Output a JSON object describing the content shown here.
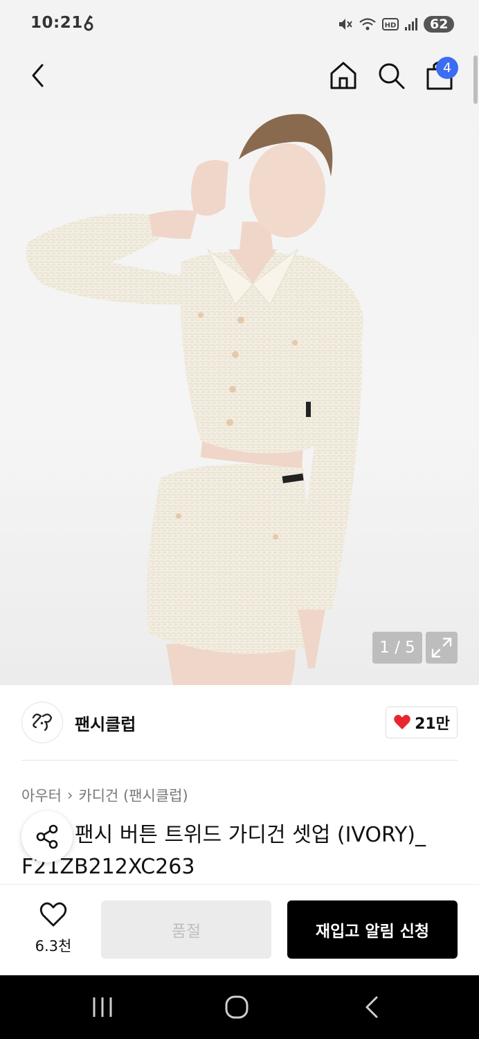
{
  "status_bar": {
    "time": "10:21",
    "icons": [
      "mute-icon",
      "wifi-icon",
      "hd-icon",
      "signal-icon"
    ],
    "battery": "62"
  },
  "nav": {
    "icons": [
      "back-icon",
      "home-icon",
      "search-icon",
      "shopping-bag-icon"
    ],
    "cart_count": "4"
  },
  "gallery": {
    "counter": "1 / 5",
    "expand_icon": "expand-icon"
  },
  "brand": {
    "logo_text": "𝔉𝔆",
    "name": "팬시클럽",
    "likes": "21만"
  },
  "breadcrumb": {
    "category": "아우터",
    "separator": "›",
    "subcategory": "카디건 (팬시클럽)"
  },
  "product": {
    "title_line1": "팬시 버튼 트위드 가디건 셋업 (IVORY)_",
    "title_line2": "F21ZB212XC263"
  },
  "actions": {
    "wish_count": "6.3천",
    "soldout_label": "품절",
    "restock_label": "재입고 알림 신청"
  },
  "colors": {
    "accent_blue": "#3b6df2",
    "heart_red": "#e8262d",
    "primary_black": "#000000"
  }
}
